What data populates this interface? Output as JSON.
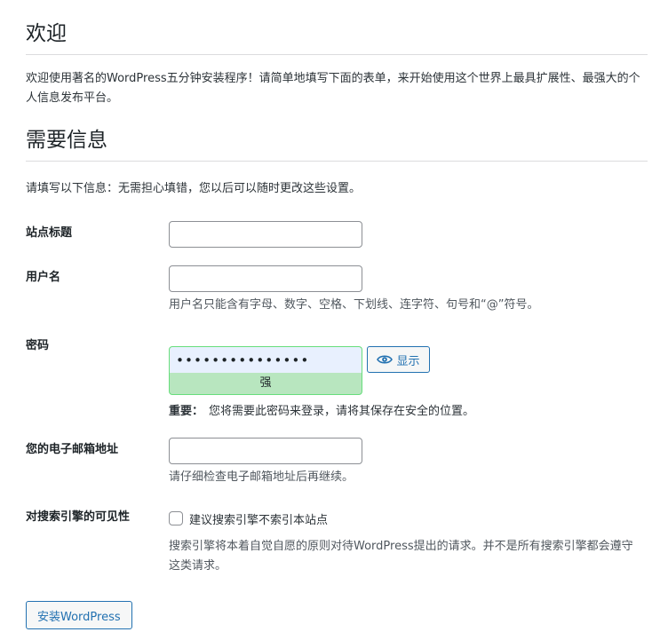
{
  "welcome": {
    "heading": "欢迎",
    "intro": "欢迎使用著名的WordPress五分钟安装程序！请简单地填写下面的表单，来开始使用这个世界上最具扩展性、最强大的个人信息发布平台。"
  },
  "info": {
    "heading": "需要信息",
    "intro": "请填写以下信息：无需担心填错，您以后可以随时更改这些设置。"
  },
  "form": {
    "site_title": {
      "label": "站点标题",
      "value": ""
    },
    "username": {
      "label": "用户名",
      "value": "",
      "hint": "用户名只能含有字母、数字、空格、下划线、连字符、句号和“@”符号。"
    },
    "password": {
      "label": "密码",
      "value": "•••••••••••••••",
      "show_label": "显示",
      "strength": "强",
      "note_strong": "重要：",
      "note": "您将需要此密码来登录，请将其保存在安全的位置。"
    },
    "email": {
      "label": "您的电子邮箱地址",
      "value": "",
      "hint": "请仔细检查电子邮箱地址后再继续。"
    },
    "search_visibility": {
      "label": "对搜索引擎的可见性",
      "checkbox_label": "建议搜索引擎不索引本站点",
      "checked": false,
      "description": "搜索引擎将本着自觉自愿的原则对待WordPress提出的请求。并不是所有搜索引擎都会遵守这类请求。"
    },
    "submit_label": "安装WordPress"
  },
  "colors": {
    "accent": "#2271b1",
    "strength_bg": "#b8e6bf",
    "strength_border": "#68de7c",
    "autofill_bg": "#e8f0fe"
  },
  "icons": {
    "show_password": "eye-icon"
  }
}
